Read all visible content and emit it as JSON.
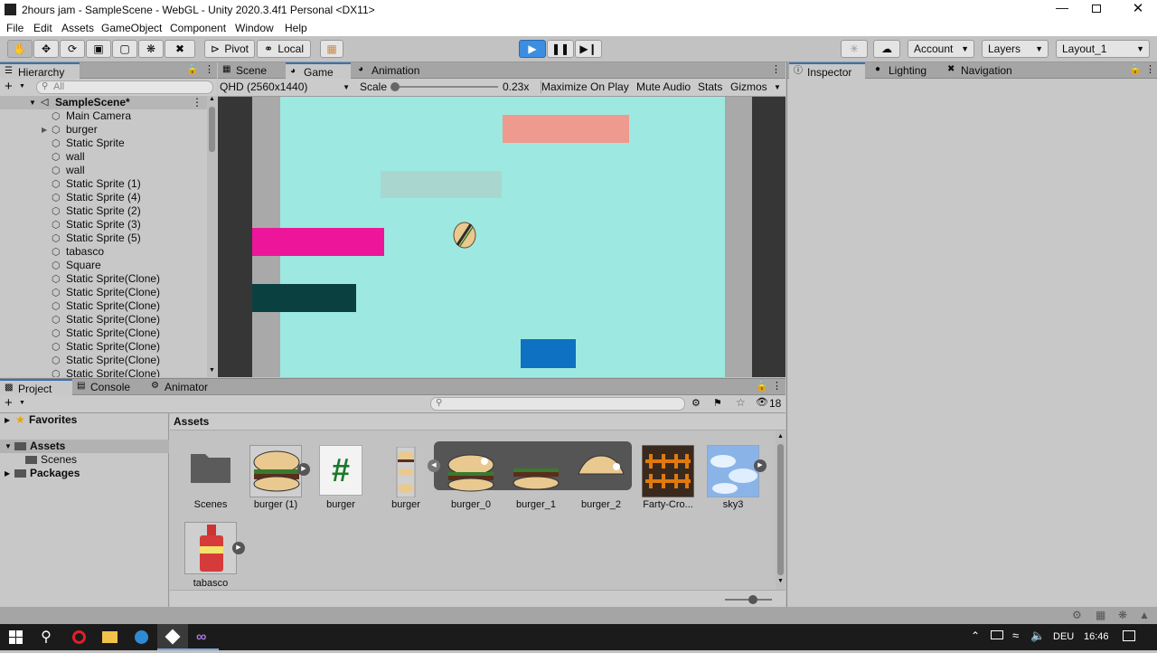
{
  "window": {
    "title": "2hours jam - SampleScene - WebGL - Unity 2020.3.4f1 Personal <DX11>"
  },
  "menu": [
    "File",
    "Edit",
    "Assets",
    "GameObject",
    "Component",
    "Window",
    "Help"
  ],
  "toolbar": {
    "pivot": "Pivot",
    "local": "Local",
    "account": "Account",
    "layers": "Layers",
    "layout": "Layout_1"
  },
  "hierarchy": {
    "tab": "Hierarchy",
    "search_placeholder": "All",
    "scene": "SampleScene*",
    "items": [
      "Main Camera",
      "burger",
      "Static Sprite",
      "wall",
      "wall",
      "Static Sprite (1)",
      "Static Sprite (4)",
      "Static Sprite (2)",
      "Static Sprite (3)",
      "Static Sprite (5)",
      "tabasco",
      "Square",
      "Static Sprite(Clone)",
      "Static Sprite(Clone)",
      "Static Sprite(Clone)",
      "Static Sprite(Clone)",
      "Static Sprite(Clone)",
      "Static Sprite(Clone)",
      "Static Sprite(Clone)",
      "Static Sprite(Clone)"
    ]
  },
  "center_tabs": {
    "scene": "Scene",
    "game": "Game",
    "animation": "Animation"
  },
  "game_bar": {
    "resolution": "QHD (2560x1440)",
    "scale_label": "Scale",
    "scale_value": "0.23x",
    "maximize": "Maximize On Play",
    "mute": "Mute Audio",
    "stats": "Stats",
    "gizmos": "Gizmos"
  },
  "game_colors": {
    "background": "#9de9e1",
    "pink_top": "#ee9a8e",
    "grey_mid": "#a9d7cf",
    "magenta": "#ed169b",
    "dark_teal": "#0b4040",
    "blue": "#0e71c1"
  },
  "right_tabs": {
    "inspector": "Inspector",
    "lighting": "Lighting",
    "navigation": "Navigation"
  },
  "bottom_tabs": {
    "project": "Project",
    "console": "Console",
    "animator": "Animator"
  },
  "project": {
    "hidden_count": "18",
    "favorites": "Favorites",
    "assets": "Assets",
    "scenes": "Scenes",
    "packages": "Packages",
    "breadcrumb": "Assets",
    "items": [
      "Scenes",
      "burger (1)",
      "burger",
      "burger",
      "burger_0",
      "burger_1",
      "burger_2",
      "Farty-Cro...",
      "sky3",
      "tabasco"
    ]
  },
  "tray": {
    "language": "DEU",
    "time": "16:46"
  }
}
